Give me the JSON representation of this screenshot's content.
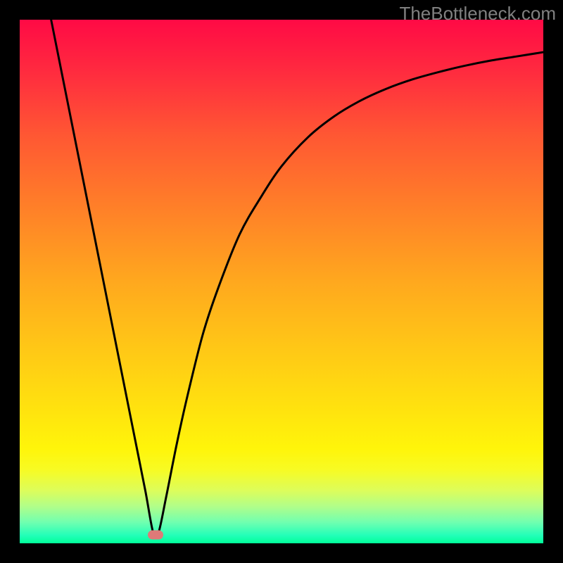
{
  "watermark": "TheBottleneck.com",
  "chart_data": {
    "type": "line",
    "title": "",
    "xlabel": "",
    "ylabel": "",
    "xlim": [
      0,
      100
    ],
    "ylim": [
      0,
      100
    ],
    "grid": false,
    "legend": false,
    "gradient_stops": [
      {
        "offset": 0.0,
        "color": "#ff0a45"
      },
      {
        "offset": 0.1,
        "color": "#ff2b3f"
      },
      {
        "offset": 0.22,
        "color": "#ff5733"
      },
      {
        "offset": 0.35,
        "color": "#ff7d29"
      },
      {
        "offset": 0.5,
        "color": "#ffa81e"
      },
      {
        "offset": 0.63,
        "color": "#ffc816"
      },
      {
        "offset": 0.75,
        "color": "#ffe40e"
      },
      {
        "offset": 0.82,
        "color": "#fff50a"
      },
      {
        "offset": 0.86,
        "color": "#f7fb24"
      },
      {
        "offset": 0.9,
        "color": "#dcfd5c"
      },
      {
        "offset": 0.93,
        "color": "#b0fe8a"
      },
      {
        "offset": 0.96,
        "color": "#70ffb0"
      },
      {
        "offset": 0.985,
        "color": "#22ffb8"
      },
      {
        "offset": 1.0,
        "color": "#00ff99"
      }
    ],
    "series": [
      {
        "name": "bottleneck-curve",
        "color": "#000000",
        "width": 3,
        "x": [
          6,
          8,
          10,
          12,
          14,
          16,
          18,
          20,
          22,
          24,
          25.5,
          26.5,
          28,
          30,
          32,
          35,
          38,
          42,
          46,
          50,
          55,
          60,
          65,
          70,
          75,
          80,
          85,
          90,
          95,
          100
        ],
        "y": [
          100,
          90,
          80,
          70,
          60,
          50,
          40,
          30,
          20,
          10,
          2,
          2,
          9,
          19,
          28,
          40,
          49,
          59,
          66,
          72,
          77.5,
          81.5,
          84.5,
          86.8,
          88.6,
          90,
          91.2,
          92.2,
          93,
          93.8
        ]
      }
    ],
    "marker": {
      "x": 26,
      "y": 1.6,
      "color": "#de7a78"
    }
  }
}
